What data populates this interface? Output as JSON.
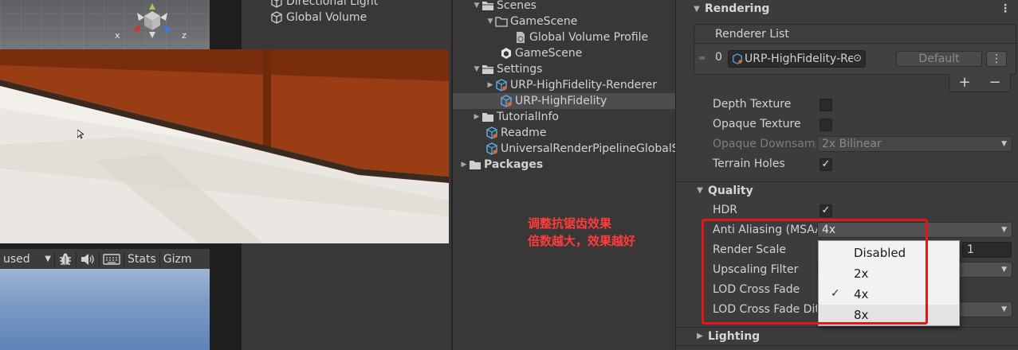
{
  "hierarchy": {
    "items": [
      "Directional Light",
      "Global Volume"
    ]
  },
  "game_toolbar": {
    "display_label": "used",
    "stats_label": "Stats",
    "gizmos_label": "Gizm"
  },
  "gizmo": {
    "x_label": "x",
    "z_label": "z"
  },
  "project": {
    "rows": [
      {
        "label": "Scenes",
        "bold": false
      },
      {
        "label": "GameScene"
      },
      {
        "label": "Global Volume Profile"
      },
      {
        "label": "GameScene"
      },
      {
        "label": "Settings"
      },
      {
        "label": "URP-HighFidelity-Renderer"
      },
      {
        "label": "URP-HighFidelity"
      },
      {
        "label": "TutorialInfo"
      },
      {
        "label": "Readme"
      },
      {
        "label": "UniversalRenderPipelineGlobalSettings"
      },
      {
        "label": "Packages"
      }
    ]
  },
  "annotation": {
    "line1": "调整抗锯齿效果",
    "line2": "倍数越大，效果越好"
  },
  "inspector": {
    "rendering": {
      "title": "Rendering",
      "renderer_list_label": "Renderer List",
      "renderer_index": "0",
      "renderer_name": "URP-HighFidelity-Renderer",
      "default_label": "Default",
      "depth_texture_label": "Depth Texture",
      "opaque_texture_label": "Opaque Texture",
      "opaque_downsampling_label": "Opaque Downsampling",
      "opaque_downsampling_value": "2x Bilinear",
      "terrain_holes_label": "Terrain Holes",
      "depth_texture": false,
      "opaque_texture": false,
      "terrain_holes": true
    },
    "quality": {
      "title": "Quality",
      "hdr_label": "HDR",
      "hdr": true,
      "anti_aliasing_label": "Anti Aliasing (MSAA)",
      "anti_aliasing_value": "4x",
      "render_scale_label": "Render Scale",
      "render_scale_value": "1",
      "upscaling_filter_label": "Upscaling Filter",
      "lod_cross_fade_label": "LOD Cross Fade",
      "lod_cross_fade_dither_label": "LOD Cross Fade Dithering"
    },
    "lighting": {
      "title": "Lighting"
    }
  },
  "aa_menu": {
    "options": [
      "Disabled",
      "2x",
      "4x",
      "8x"
    ],
    "selected": "4x",
    "hovered": "8x"
  }
}
